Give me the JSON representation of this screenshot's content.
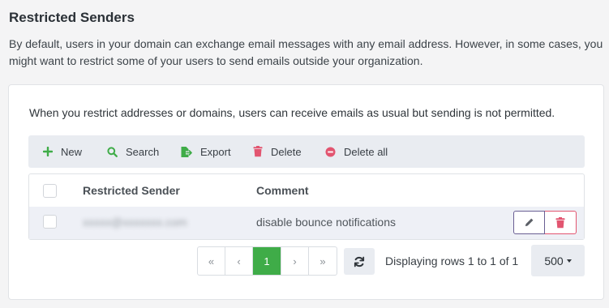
{
  "header": {
    "title": "Restricted Senders",
    "description": "By default, users in your domain can exchange email messages with any email address. However, in some cases, you might want to restrict some of your users to send emails outside your organization."
  },
  "card": {
    "note": "When you restrict addresses or domains, users can receive emails as usual but sending is not permitted."
  },
  "toolbar": {
    "new_label": "New",
    "search_label": "Search",
    "export_label": "Export",
    "delete_label": "Delete",
    "delete_all_label": "Delete all"
  },
  "table": {
    "columns": [
      "Restricted Sender",
      "Comment"
    ],
    "rows": [
      {
        "sender": "xxxxx@xxxxxxx.com",
        "comment": "disable bounce notifications"
      }
    ]
  },
  "pagination": {
    "first": "«",
    "prev": "‹",
    "current": "1",
    "next": "›",
    "last": "»",
    "status": "Displaying rows 1 to 1 of 1",
    "page_size": "500"
  },
  "colors": {
    "accent_green": "#3fac48",
    "danger_red": "#e25570",
    "edit_purple": "#6a5f93"
  }
}
